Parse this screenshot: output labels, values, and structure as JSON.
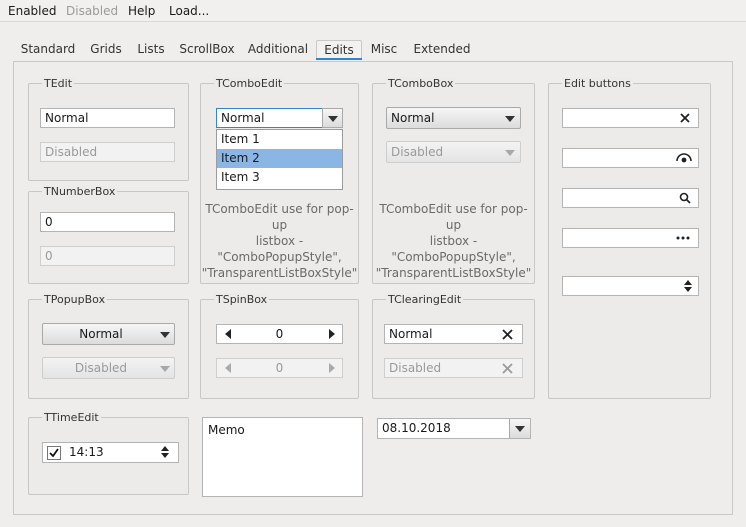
{
  "menu": {
    "items": [
      {
        "label": "Enabled",
        "disabled": false
      },
      {
        "label": "Disabled",
        "disabled": true
      },
      {
        "label": "Help",
        "disabled": false
      },
      {
        "label": "Load...",
        "disabled": false
      }
    ]
  },
  "tabs": [
    "Standard",
    "Grids",
    "Lists",
    "ScrollBox",
    "Additional",
    "Edits",
    "Misc",
    "Extended"
  ],
  "active_tab": "Edits",
  "tedit": {
    "title": "TEdit",
    "normal": "Normal",
    "disabled": "Disabled"
  },
  "tnumberbox": {
    "title": "TNumberBox",
    "value1": "0",
    "value2": "0"
  },
  "tcomboedit": {
    "title": "TComboEdit",
    "value": "Normal",
    "items": [
      "Item 1",
      "Item 2",
      "Item 3"
    ],
    "selected_index": 1,
    "note_line1": "TComboEdit use for pop-up",
    "note_line2": "listbox -",
    "note_line3": "\"ComboPopupStyle\",",
    "note_line4": "\"TransparentListBoxStyle\""
  },
  "tcombobox": {
    "title": "TComboBox",
    "normal": "Normal",
    "disabled": "Disabled",
    "note_line1": "TComboEdit use for pop-up",
    "note_line2": "listbox -",
    "note_line3": "\"ComboPopupStyle\",",
    "note_line4": "\"TransparentListBoxStyle\""
  },
  "edit_buttons": {
    "title": "Edit buttons",
    "icons": [
      "clear-icon",
      "password-eye-icon",
      "search-icon",
      "ellipsis-icon",
      "spin-icon"
    ]
  },
  "tpopupbox": {
    "title": "TPopupBox",
    "normal": "Normal",
    "disabled": "Disabled"
  },
  "tspinbox": {
    "title": "TSpinBox",
    "value1": "0",
    "value2": "0"
  },
  "tclearingedit": {
    "title": "TClearingEdit",
    "normal": "Normal",
    "disabled": "Disabled"
  },
  "ttimeedit": {
    "title": "TTimeEdit",
    "time": "14:13",
    "checked": true
  },
  "memo": {
    "text": "Memo"
  },
  "dateedit": {
    "value": "08.10.2018"
  },
  "colors": {
    "accent": "#2e85d0",
    "selection": "#8ab6e6"
  }
}
